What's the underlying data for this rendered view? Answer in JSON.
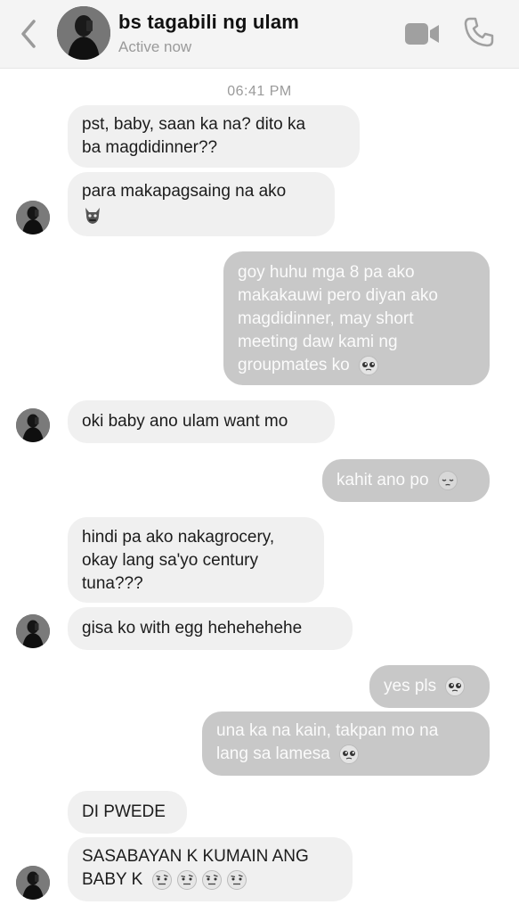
{
  "header": {
    "contact_name": "bs tagabili ng ulam",
    "status": "Active now"
  },
  "timestamp": "06:41 PM",
  "messages": [
    {
      "lines": [
        "pst, baby, saan ka na? dito ka",
        "ba magdidinner??"
      ]
    },
    {
      "lines": [
        "para makapagsaing na ako"
      ],
      "emoji": "angry-devil-emoji"
    },
    {
      "lines": [
        "goy huhu mga 8 pa ako",
        "makakauwi pero diyan ako",
        "magdidinner, may short",
        "meeting daw kami ng",
        "groupmates ko"
      ],
      "emoji": "pleading-face-emoji"
    },
    {
      "lines": [
        "oki baby ano ulam want mo"
      ]
    },
    {
      "lines": [
        "kahit ano po"
      ],
      "emoji": "pensive-face-emoji"
    },
    {
      "lines": [
        "hindi pa ako nakagrocery,",
        "okay lang sa'yo century",
        "tuna???"
      ]
    },
    {
      "lines": [
        "gisa ko with egg hehehehehe"
      ]
    },
    {
      "lines": [
        "yes pls"
      ],
      "emoji": "pleading-face-emoji"
    },
    {
      "lines": [
        "una ka na kain, takpan mo na",
        "lang sa lamesa"
      ],
      "emoji": "pleading-face-emoji"
    },
    {
      "lines": [
        "DI PWEDE"
      ]
    },
    {
      "lines": [
        "SASABAYAN K KUMAIN ANG",
        "BABY K"
      ],
      "emoji": "face-with-raised-eyebrow-emoji x4"
    }
  ],
  "colors": {
    "incoming_bubble": "#f0f0f0",
    "outgoing_bubble": "#c8c8c8",
    "header_bg": "#f4f4f4",
    "muted_text": "#9a9a9a"
  }
}
